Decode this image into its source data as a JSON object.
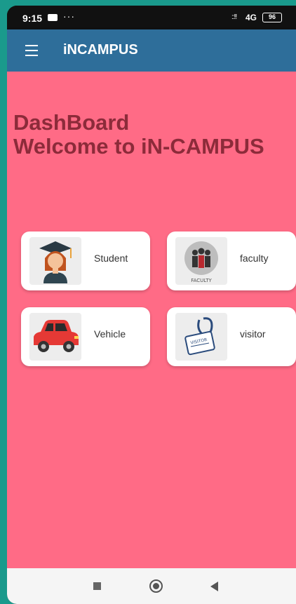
{
  "status_bar": {
    "time": "9:15",
    "dots": "···",
    "signal": "::!!",
    "network": "4G",
    "battery": "96"
  },
  "app_bar": {
    "title": "iNCAMPUS"
  },
  "dashboard": {
    "heading_line1": "DashBoard",
    "heading_line2": "Welcome to iN-CAMPUS"
  },
  "cards": [
    {
      "label": "Student",
      "icon": "student-icon"
    },
    {
      "label": "faculty",
      "icon": "faculty-icon",
      "image_text": "FACULTY"
    },
    {
      "label": "Vehicle",
      "icon": "car-icon"
    },
    {
      "label": "visitor",
      "icon": "visitor-badge-icon",
      "image_text": "VISITOR"
    }
  ],
  "colors": {
    "app_bar": "#2e6e9a",
    "background": "#ff6b86",
    "heading": "#8c2b3a"
  }
}
